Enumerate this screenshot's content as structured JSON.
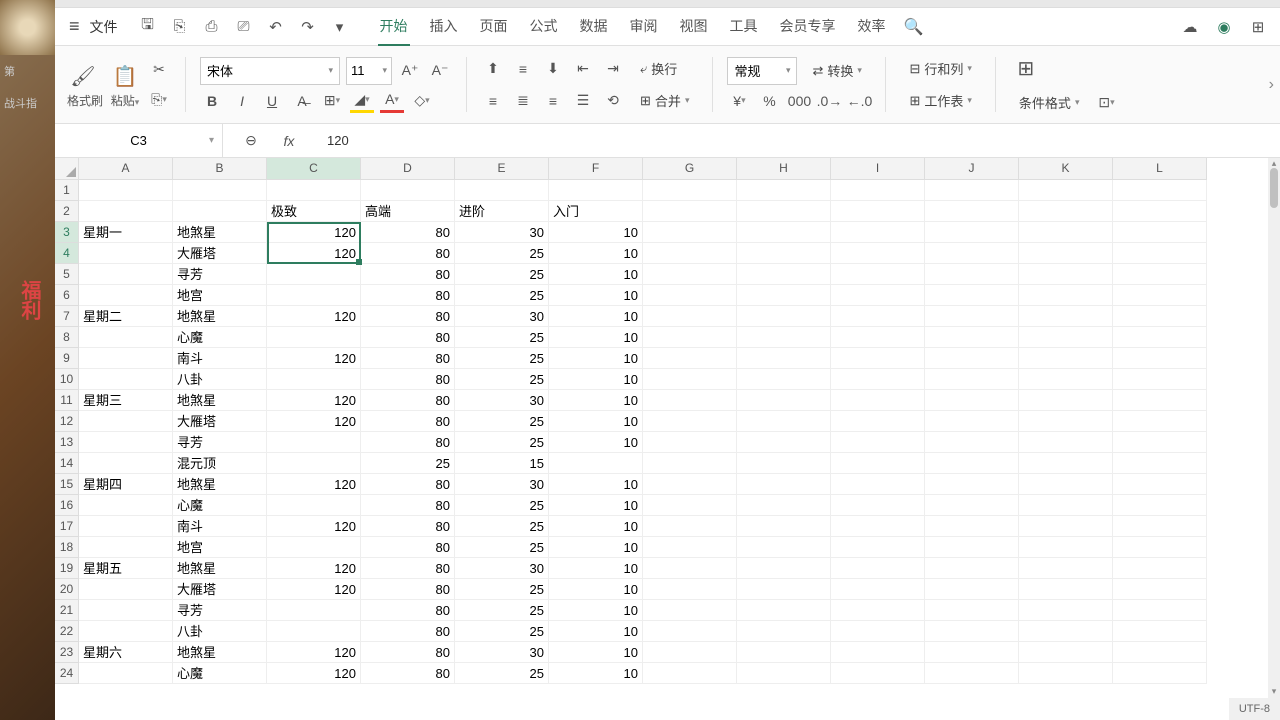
{
  "sidebar": {
    "vtext": "福利",
    "g1": "第",
    "g2": "战斗指"
  },
  "menu": {
    "file": "文件",
    "tabs": [
      "开始",
      "插入",
      "页面",
      "公式",
      "数据",
      "审阅",
      "视图",
      "工具",
      "会员专享",
      "效率"
    ],
    "active": 0
  },
  "ribbon": {
    "format_painter": "格式刷",
    "paste": "粘贴",
    "font": "宋体",
    "size": "11",
    "wrap": "换行",
    "merge": "合并",
    "general": "常规",
    "convert": "转换",
    "rowcol": "行和列",
    "worksheet": "工作表",
    "condfmt": "条件格式"
  },
  "namebox": "C3",
  "formula": "120",
  "status": "UTF-8",
  "cols": [
    "A",
    "B",
    "C",
    "D",
    "E",
    "F",
    "G",
    "H",
    "I",
    "J",
    "K",
    "L"
  ],
  "rows": [
    {
      "n": 1,
      "a": "",
      "b": "",
      "c": "",
      "d": "",
      "e": "",
      "f": ""
    },
    {
      "n": 2,
      "a": "",
      "b": "",
      "c": "极致",
      "d": "高端",
      "e": "进阶",
      "f": "入门"
    },
    {
      "n": 3,
      "a": "星期一",
      "b": "地煞星",
      "c": 120,
      "d": 80,
      "e": 30,
      "f": 10
    },
    {
      "n": 4,
      "a": "",
      "b": "大雁塔",
      "c": 120,
      "d": 80,
      "e": 25,
      "f": 10
    },
    {
      "n": 5,
      "a": "",
      "b": "寻芳",
      "c": "",
      "d": 80,
      "e": 25,
      "f": 10
    },
    {
      "n": 6,
      "a": "",
      "b": "地宫",
      "c": "",
      "d": 80,
      "e": 25,
      "f": 10
    },
    {
      "n": 7,
      "a": "星期二",
      "b": "地煞星",
      "c": 120,
      "d": 80,
      "e": 30,
      "f": 10
    },
    {
      "n": 8,
      "a": "",
      "b": "心魔",
      "c": "",
      "d": 80,
      "e": 25,
      "f": 10
    },
    {
      "n": 9,
      "a": "",
      "b": "南斗",
      "c": 120,
      "d": 80,
      "e": 25,
      "f": 10
    },
    {
      "n": 10,
      "a": "",
      "b": "八卦",
      "c": "",
      "d": 80,
      "e": 25,
      "f": 10
    },
    {
      "n": 11,
      "a": "星期三",
      "b": "地煞星",
      "c": 120,
      "d": 80,
      "e": 30,
      "f": 10
    },
    {
      "n": 12,
      "a": "",
      "b": "大雁塔",
      "c": 120,
      "d": 80,
      "e": 25,
      "f": 10
    },
    {
      "n": 13,
      "a": "",
      "b": "寻芳",
      "c": "",
      "d": 80,
      "e": 25,
      "f": 10
    },
    {
      "n": 14,
      "a": "",
      "b": "混元顶",
      "c": "",
      "d": 25,
      "e": 15,
      "f": ""
    },
    {
      "n": 15,
      "a": "星期四",
      "b": "地煞星",
      "c": 120,
      "d": 80,
      "e": 30,
      "f": 10
    },
    {
      "n": 16,
      "a": "",
      "b": "心魔",
      "c": "",
      "d": 80,
      "e": 25,
      "f": 10
    },
    {
      "n": 17,
      "a": "",
      "b": "南斗",
      "c": 120,
      "d": 80,
      "e": 25,
      "f": 10
    },
    {
      "n": 18,
      "a": "",
      "b": "地宫",
      "c": "",
      "d": 80,
      "e": 25,
      "f": 10
    },
    {
      "n": 19,
      "a": "星期五",
      "b": "地煞星",
      "c": 120,
      "d": 80,
      "e": 30,
      "f": 10
    },
    {
      "n": 20,
      "a": "",
      "b": "大雁塔",
      "c": 120,
      "d": 80,
      "e": 25,
      "f": 10
    },
    {
      "n": 21,
      "a": "",
      "b": "寻芳",
      "c": "",
      "d": 80,
      "e": 25,
      "f": 10
    },
    {
      "n": 22,
      "a": "",
      "b": "八卦",
      "c": "",
      "d": 80,
      "e": 25,
      "f": 10
    },
    {
      "n": 23,
      "a": "星期六",
      "b": "地煞星",
      "c": 120,
      "d": 80,
      "e": 30,
      "f": 10
    },
    {
      "n": 24,
      "a": "",
      "b": "心魔",
      "c": 120,
      "d": 80,
      "e": 25,
      "f": 10
    }
  ],
  "selection": {
    "fromRow": 3,
    "toRow": 4,
    "col": "C"
  }
}
